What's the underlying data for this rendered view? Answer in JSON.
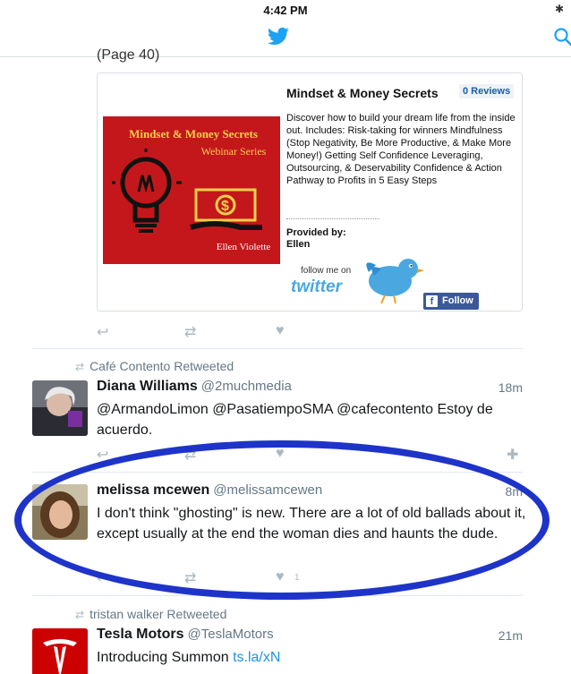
{
  "status_bar": {
    "time": "4:42 PM",
    "bluetooth_icon": "bluetooth-icon"
  },
  "nav": {
    "logo_icon": "twitter-bird-icon",
    "search_icon": "search-icon"
  },
  "clipped_text": "(Page 40)",
  "card": {
    "banner": {
      "title": "Mindset & Money Secrets",
      "subtitle": "Webinar Series",
      "author": "Ellen Violette"
    },
    "title": "Mindset & Money Secrets",
    "reviews": "0 Reviews",
    "description": "Discover how to build your dream life from the inside out. Includes: Risk-taking for winners Mindfulness (Stop Negativity, Be More Productive, & Make More Money!) Getting Self Confidence Leveraging, Outsourcing, & Deservability Confidence & Action Pathway to Profits in 5 Easy Steps",
    "provided_by": "Provided by:",
    "provider": "Ellen",
    "follow_me": "follow me on",
    "twitter_word": "twitter",
    "fb_follow": "Follow"
  },
  "tweets": [
    {
      "retweeted_by": "Café Contento Retweeted",
      "name": "Diana Williams",
      "handle": "@2muchmedia",
      "time": "18m",
      "text": "@ArmandoLimon @PasatiempoSMA @cafecontento Estoy de acuerdo."
    },
    {
      "name": "melissa mcewen",
      "handle": "@melissamcewen",
      "time": "8m",
      "text": "I don't think \"ghosting\" is new. There are a lot of old ballads about it, except usually at the end the woman dies and haunts the dude.",
      "like_count": "1"
    },
    {
      "retweeted_by": "tristan walker Retweeted",
      "name": "Tesla Motors",
      "handle": "@TeslaMotors",
      "time": "21m",
      "text": "Introducing Summon ",
      "link": "ts.la/xN"
    }
  ],
  "colors": {
    "annotation_circle": "#1e34c9",
    "link": "#1b95e0",
    "twitter_blue": "#1da1f2"
  }
}
